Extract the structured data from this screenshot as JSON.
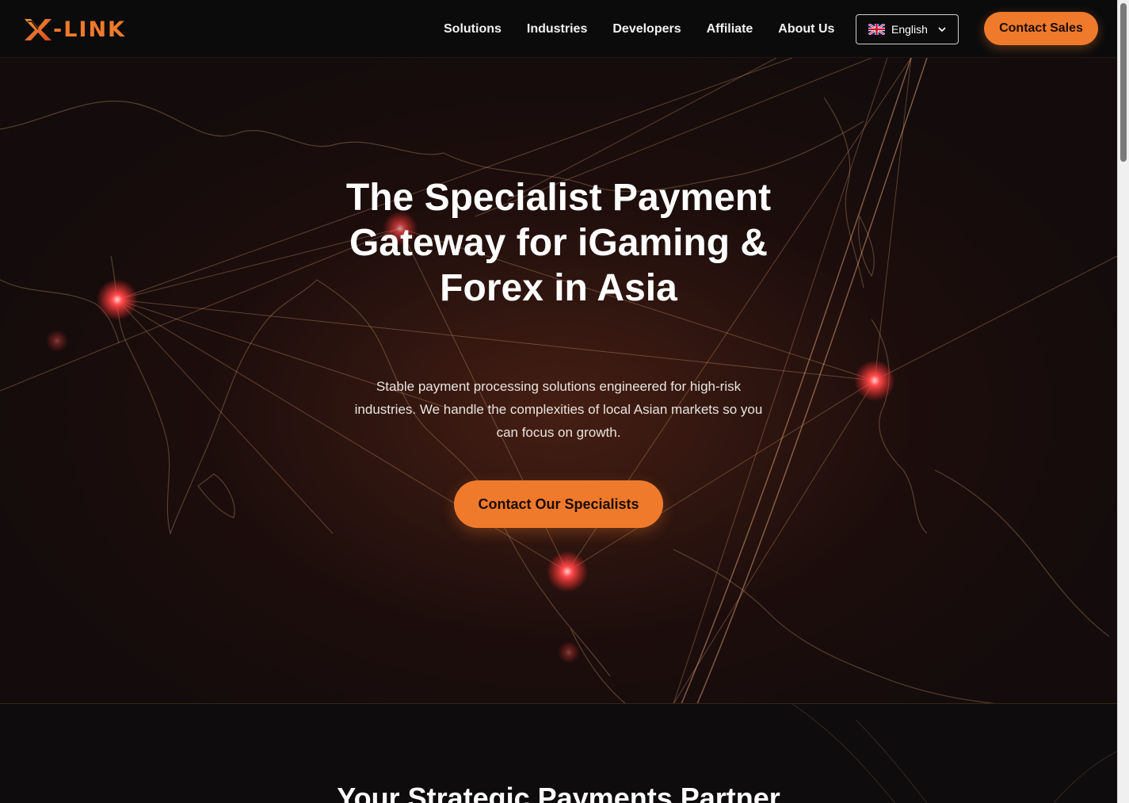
{
  "header": {
    "logo_text": "-LINK",
    "nav": [
      "Solutions",
      "Industries",
      "Developers",
      "Affiliate",
      "About Us"
    ],
    "language": {
      "label": "English",
      "flag": "uk-flag-icon"
    },
    "contact_sales": "Contact Sales"
  },
  "hero": {
    "title": "The Specialist Payment Gateway for iGaming & Forex in Asia",
    "subtitle": "Stable payment processing solutions engineered for high-risk industries. We handle the complexities of local Asian markets so you can focus on growth.",
    "cta": "Contact Our Specialists"
  },
  "section2": {
    "title": "Your Strategic Payments Partner"
  },
  "colors": {
    "accent": "#f07a2c",
    "background": "#140c0c",
    "header_bg": "#0b0b0c",
    "node_glow": "#ff3b3b"
  }
}
